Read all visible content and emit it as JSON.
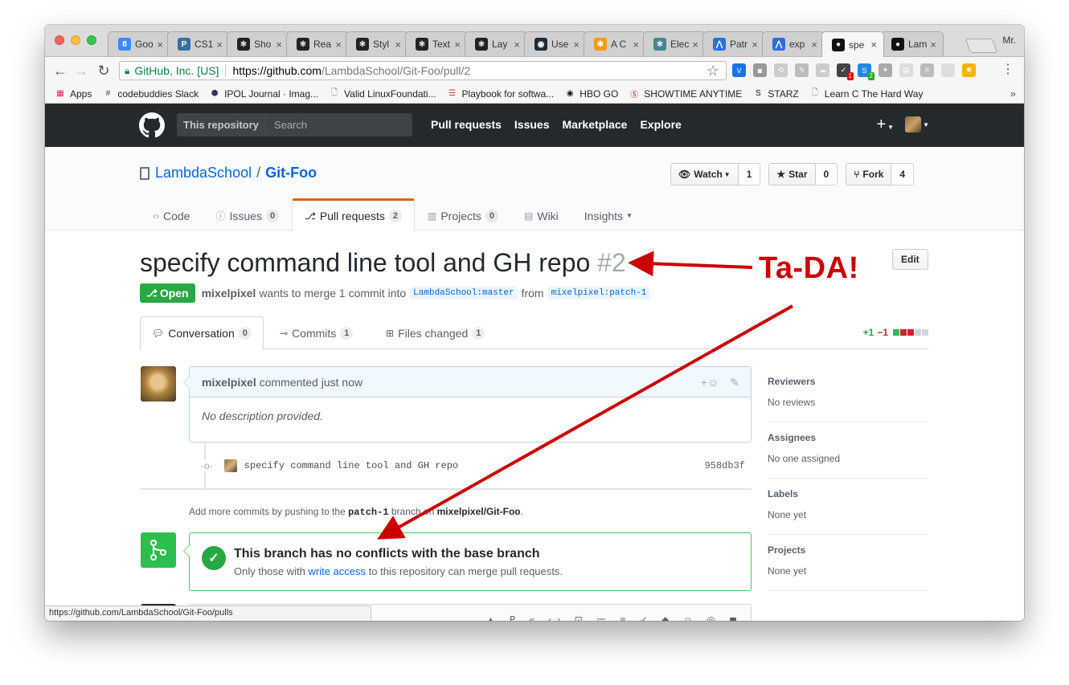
{
  "browser": {
    "tabs": [
      {
        "title": "Goo",
        "icon": "calendar-icon",
        "color": "#4285f4",
        "glyph": "8"
      },
      {
        "title": "CS1",
        "icon": "p-icon",
        "color": "#3a6ea5",
        "glyph": "P"
      },
      {
        "title": "Sho",
        "icon": "react-icon",
        "color": "#222222",
        "glyph": "⚛"
      },
      {
        "title": "Rea",
        "icon": "react-icon",
        "color": "#222222",
        "glyph": "⚛"
      },
      {
        "title": "Styl",
        "icon": "react-icon",
        "color": "#222222",
        "glyph": "⚛"
      },
      {
        "title": "Text",
        "icon": "react-icon",
        "color": "#222222",
        "glyph": "⚛"
      },
      {
        "title": "Lay",
        "icon": "react-icon",
        "color": "#222222",
        "glyph": "⚛"
      },
      {
        "title": "Use",
        "icon": "circle-icon",
        "color": "#1e2b37",
        "glyph": "◉"
      },
      {
        "title": "A C",
        "icon": "asterisk-icon",
        "color": "#f39c12",
        "glyph": "✱"
      },
      {
        "title": "Elec",
        "icon": "electron-icon",
        "color": "#47848f",
        "glyph": "⚛"
      },
      {
        "title": "Patr",
        "icon": "triangle-icon",
        "color": "#2a6fdb",
        "glyph": "⋀"
      },
      {
        "title": "exp",
        "icon": "triangle-icon",
        "color": "#2a6fdb",
        "glyph": "⋀"
      },
      {
        "title": "spe",
        "icon": "github-icon",
        "color": "#111111",
        "glyph": "●",
        "active": true
      },
      {
        "title": "Lam",
        "icon": "github-icon",
        "color": "#111111",
        "glyph": "●"
      }
    ],
    "close_glyph": "×",
    "profile": "Mr.",
    "security_label": "GitHub, Inc. [US]",
    "url_host": "https://github.com",
    "url_path": "/LambdaSchool/Git-Foo/pull/2",
    "bookmarks": [
      {
        "label": "Apps",
        "icon": "apps-grid-icon"
      },
      {
        "label": "codebuddies Slack",
        "icon": "hash-icon"
      },
      {
        "label": "IPOL Journal · Imag...",
        "icon": "hexagon-icon"
      },
      {
        "label": "Valid LinuxFoundati...",
        "icon": "page-icon"
      },
      {
        "label": "Playbook for softwa...",
        "icon": "playbook-icon"
      },
      {
        "label": "HBO GO",
        "icon": "hbo-icon"
      },
      {
        "label": "SHOWTIME ANYTIME",
        "icon": "showtime-icon"
      },
      {
        "label": "STARZ",
        "icon": "starz-icon"
      },
      {
        "label": "Learn C The Hard Way",
        "icon": "page-icon"
      }
    ],
    "status_url": "https://github.com/LambdaSchool/Git-Foo/pulls"
  },
  "github": {
    "scope_label": "This repository",
    "search_placeholder": "Search",
    "nav": [
      "Pull requests",
      "Issues",
      "Marketplace",
      "Explore"
    ]
  },
  "repo": {
    "owner": "LambdaSchool",
    "name": "Git-Foo",
    "watch": {
      "label": "Watch",
      "count": "1"
    },
    "star": {
      "label": "Star",
      "count": "0"
    },
    "fork": {
      "label": "Fork",
      "count": "4"
    },
    "tabs": [
      {
        "label": "Code",
        "icon": "code-icon",
        "count": ""
      },
      {
        "label": "Issues",
        "icon": "issue-icon",
        "count": "0"
      },
      {
        "label": "Pull requests",
        "icon": "pr-icon",
        "count": "2",
        "selected": true
      },
      {
        "label": "Projects",
        "icon": "project-icon",
        "count": "0"
      },
      {
        "label": "Wiki",
        "icon": "book-icon",
        "count": ""
      },
      {
        "label": "Insights",
        "icon": "",
        "count": ""
      }
    ]
  },
  "pr": {
    "title": "specify command line tool and GH repo",
    "number": "#2",
    "edit_label": "Edit",
    "state": "Open",
    "author": "mixelpixel",
    "meta_text": "wants to merge 1 commit into",
    "base_branch": "LambdaSchool:master",
    "from_text": "from",
    "head_branch": "mixelpixel:patch-1",
    "tabs": [
      {
        "label": "Conversation",
        "count": "0"
      },
      {
        "label": "Commits",
        "count": "1"
      },
      {
        "label": "Files changed",
        "count": "1"
      }
    ],
    "additions": "+1",
    "deletions": "−1",
    "diffstat_colors": [
      "#2cbe4e",
      "#cb2431",
      "#cb2431",
      "#d1d5da",
      "#d1d5da"
    ]
  },
  "comment": {
    "author": "mixelpixel",
    "time": "commented just now",
    "body": "No description provided."
  },
  "commit": {
    "message": "specify command line tool and GH repo",
    "sha": "958db3f"
  },
  "push_hint": {
    "prefix": "Add more commits by pushing to the",
    "branch": "patch-1",
    "middle": "branch on",
    "repo": "mixelpixel/Git-Foo",
    "suffix": "."
  },
  "merge": {
    "title": "This branch has no conflicts with the base branch",
    "desc_prefix": "Only those with",
    "desc_link": "write access",
    "desc_suffix": "to this repository can merge pull requests."
  },
  "sidebar": [
    {
      "heading": "Reviewers",
      "value": "No reviews"
    },
    {
      "heading": "Assignees",
      "value": "No one assigned"
    },
    {
      "heading": "Labels",
      "value": "None yet"
    },
    {
      "heading": "Projects",
      "value": "None yet"
    }
  ],
  "annotation": {
    "text": "Ta-DA!",
    "color": "#cc0000"
  }
}
